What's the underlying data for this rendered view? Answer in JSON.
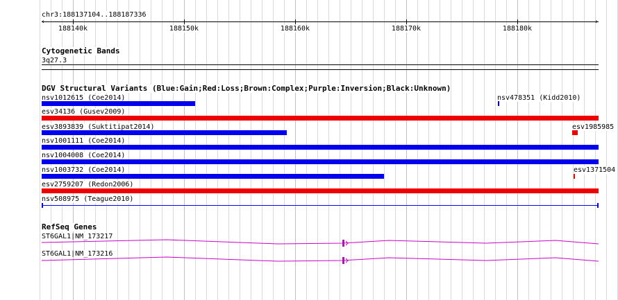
{
  "ruler": {
    "range_label": "chr3:188137104..188187336",
    "ticks": [
      "188140k",
      "188150k",
      "188160k",
      "188170k",
      "188180k"
    ]
  },
  "cytoband": {
    "title": "Cytogenetic Bands",
    "band": "3q27.3"
  },
  "dgv": {
    "title": "DGV Structural Variants (Blue:Gain;Red:Loss;Brown:Complex;Purple:Inversion;Black:Unknown)",
    "colors": {
      "gain": "#0000ee",
      "loss": "#ee0000",
      "inversion": "#cc00cc"
    },
    "variants": [
      {
        "label": "nsv1012615 (Coe2014)",
        "type": "gain"
      },
      {
        "label": "nsv478351 (Kidd2010)",
        "type": "gain"
      },
      {
        "label": "esv34136 (Gusev2009)",
        "type": "loss"
      },
      {
        "label": "esv3893839 (Suktitipat2014)",
        "type": "gain"
      },
      {
        "label": "esv1985985",
        "type": "loss"
      },
      {
        "label": "nsv1001111 (Coe2014)",
        "type": "gain"
      },
      {
        "label": "nsv1004008 (Coe2014)",
        "type": "gain"
      },
      {
        "label": "nsv1003732 (Coe2014)",
        "type": "gain"
      },
      {
        "label": "esv1371504",
        "type": "loss"
      },
      {
        "label": "esv2759207 (Redon2006)",
        "type": "loss"
      },
      {
        "label": "nsv508975 (Teague2010)",
        "type": "gain"
      }
    ]
  },
  "refseq": {
    "title": "RefSeq Genes",
    "genes": [
      {
        "label": "ST6GAL1|NM_173217"
      },
      {
        "label": "ST6GAL1|NM_173216"
      }
    ]
  }
}
